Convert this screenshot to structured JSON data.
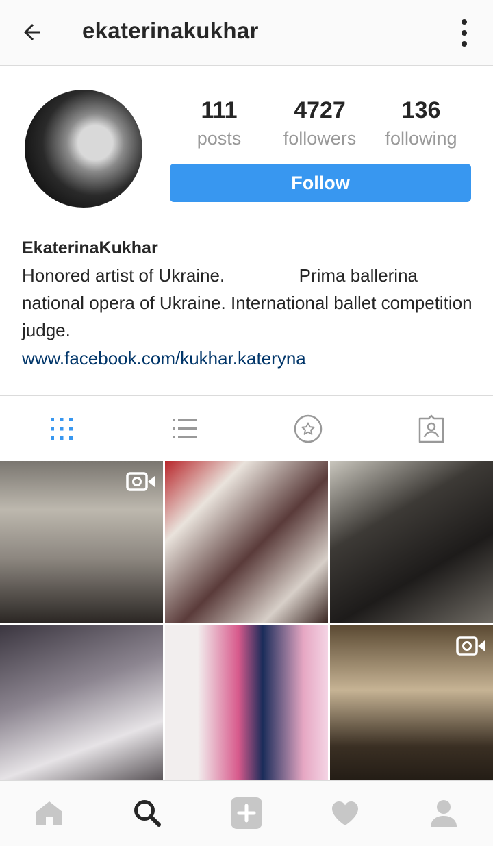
{
  "header": {
    "username": "ekaterinakukhar",
    "back_icon": "arrow-left-icon",
    "menu_icon": "more-vertical-icon"
  },
  "profile": {
    "stats": [
      {
        "value": "111",
        "label": "posts"
      },
      {
        "value": "4727",
        "label": "followers"
      },
      {
        "value": "136",
        "label": "following"
      }
    ],
    "follow_label": "Follow",
    "name": "EkaterinaKukhar",
    "bio": "Honored artist of Ukraine.               Prima ballerina national opera of Ukraine. International ballet competition judge.",
    "link": "www.facebook.com/kukhar.kateryna"
  },
  "tabs": [
    {
      "icon": "grid-icon",
      "active": true
    },
    {
      "icon": "list-icon",
      "active": false
    },
    {
      "icon": "star-circle-icon",
      "active": false
    },
    {
      "icon": "tagged-person-icon",
      "active": false
    }
  ],
  "posts": [
    {
      "type": "video"
    },
    {
      "type": "photo"
    },
    {
      "type": "photo"
    },
    {
      "type": "photo"
    },
    {
      "type": "photo"
    },
    {
      "type": "video"
    }
  ],
  "bottom_nav": [
    {
      "icon": "home-icon",
      "active": false
    },
    {
      "icon": "search-icon",
      "active": true
    },
    {
      "icon": "add-icon",
      "active": false
    },
    {
      "icon": "heart-icon",
      "active": false
    },
    {
      "icon": "profile-icon",
      "active": false
    }
  ],
  "colors": {
    "accent": "#3897f0",
    "link": "#003569",
    "muted": "#999999",
    "text": "#262626",
    "inactive_icon": "#c7c7c7"
  }
}
